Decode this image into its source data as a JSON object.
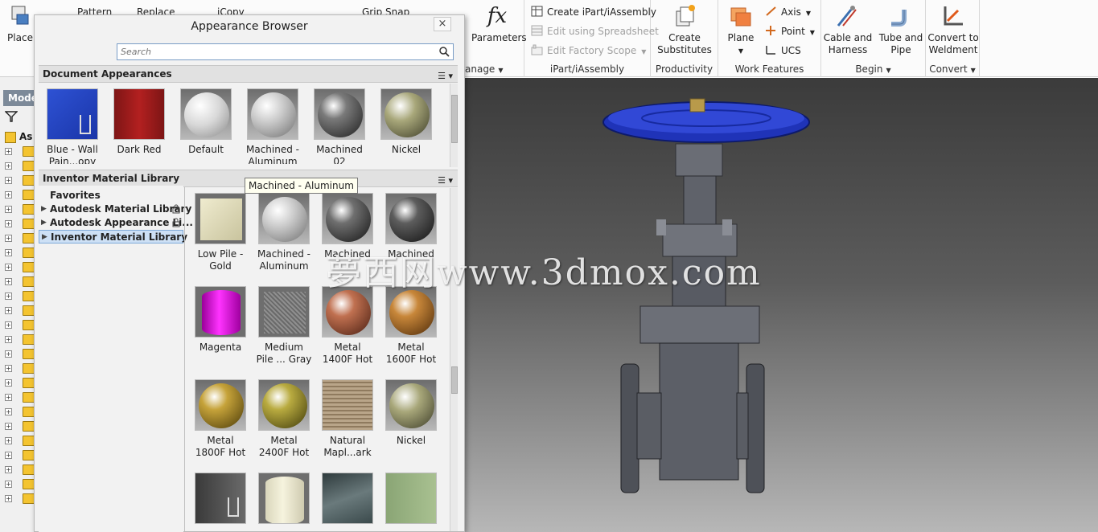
{
  "ribbon": {
    "place": {
      "label": "Place"
    },
    "top_partial": {
      "pattern": "Pattern",
      "replace": "Replace",
      "icopy": "iCopy",
      "grip_snap": "Grip Snap"
    },
    "manage_partial": "anage",
    "parameters": {
      "label": "Parameters",
      "glyph": "fx"
    },
    "ipart": {
      "create": "Create iPart/iAssembly",
      "edit_spreadsheet": "Edit using Spreadsheet",
      "edit_factory": "Edit Factory Scope",
      "group": "iPart/iAssembly"
    },
    "productivity": {
      "create_substitutes_1": "Create",
      "create_substitutes_2": "Substitutes",
      "group": "Productivity"
    },
    "work_features": {
      "plane": "Plane",
      "axis": "Axis",
      "point": "Point",
      "ucs": "UCS",
      "group": "Work Features"
    },
    "begin": {
      "cable_1": "Cable and",
      "cable_2": "Harness",
      "tube_1": "Tube and",
      "tube_2": "Pipe",
      "group": "Begin"
    },
    "convert": {
      "weld_1": "Convert to",
      "weld_2": "Weldment",
      "group": "Convert"
    }
  },
  "left_browser": {
    "tab_partial": "Mode",
    "root_partial": "As"
  },
  "appearance_browser": {
    "title": "Appearance Browser",
    "close": "×",
    "search_placeholder": "Search",
    "document_section": {
      "title": "Document Appearances",
      "items": [
        {
          "line1": "Blue - Wall",
          "line2": "Pain...opy"
        },
        {
          "line1": "Dark Red",
          "line2": ""
        },
        {
          "line1": "Default",
          "line2": ""
        },
        {
          "line1": "Machined -",
          "line2": "Aluminum"
        },
        {
          "line1": "Machined",
          "line2": "02"
        },
        {
          "line1": "Nickel",
          "line2": ""
        }
      ]
    },
    "library_section": {
      "title": "Inventor Material Library"
    },
    "libraries": [
      {
        "label": "Favorites"
      },
      {
        "label": "Autodesk Material Library"
      },
      {
        "label": "Autodesk Appearance Li..."
      },
      {
        "label": "Inventor Material Library"
      }
    ],
    "library_items": [
      {
        "line1": "Low Pile -",
        "line2": "Gold"
      },
      {
        "line1": "Machined -",
        "line2": "Aluminum"
      },
      {
        "line1": "Machined",
        "line2": ""
      },
      {
        "line1": "Machined",
        "line2": ""
      },
      {
        "line1": "Magenta",
        "line2": ""
      },
      {
        "line1": "Medium",
        "line2": "Pile ... Gray"
      },
      {
        "line1": "Metal",
        "line2": "1400F Hot"
      },
      {
        "line1": "Metal",
        "line2": "1600F Hot"
      },
      {
        "line1": "Metal",
        "line2": "1800F Hot"
      },
      {
        "line1": "Metal",
        "line2": "2400F Hot"
      },
      {
        "line1": "Natural",
        "line2": "Mapl...ark"
      },
      {
        "line1": "Nickel",
        "line2": ""
      }
    ],
    "tooltip": "Machined - Aluminum"
  },
  "watermark": "夢西网www.3dmox.com",
  "colors": {
    "selection": "#cde0f5",
    "valve_handle": "#2a3fd0",
    "viewport_top": "#3b3b3b",
    "folder": "#f4c430"
  }
}
